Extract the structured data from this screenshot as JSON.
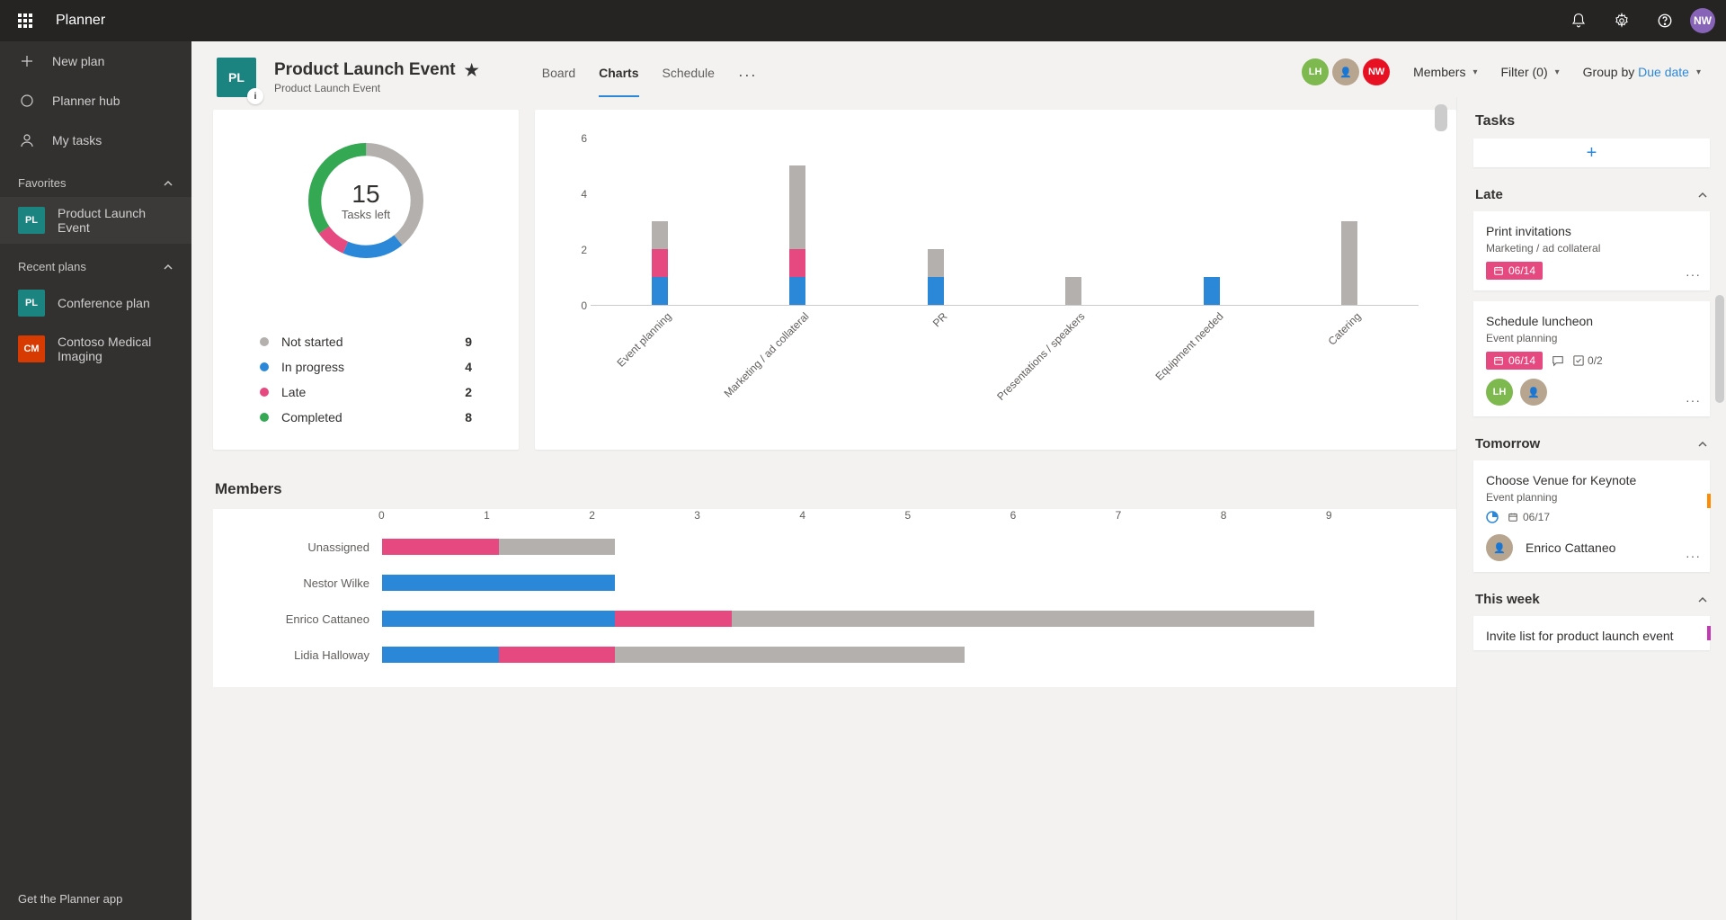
{
  "app_name": "Planner",
  "user_initials": "NW",
  "sidebar": {
    "new_plan": "New plan",
    "planner_hub": "Planner hub",
    "my_tasks": "My tasks",
    "favorites_label": "Favorites",
    "favorites": [
      {
        "initials": "PL",
        "name": "Product Launch Event",
        "color": "#1b8481",
        "active": true
      }
    ],
    "recent_label": "Recent plans",
    "recent": [
      {
        "initials": "PL",
        "name": "Conference plan",
        "color": "#1b8481"
      },
      {
        "initials": "CM",
        "name": "Contoso Medical Imaging",
        "color": "#d83b01"
      }
    ],
    "footer": "Get the Planner app"
  },
  "plan": {
    "initials": "PL",
    "title": "Product Launch Event",
    "subtitle": "Product Launch Event",
    "tabs": {
      "board": "Board",
      "charts": "Charts",
      "schedule": "Schedule"
    },
    "members_label": "Members",
    "filter_label": "Filter (0)",
    "group_label": "Group by ",
    "group_value": "Due date",
    "header_avatars": [
      {
        "initials": "LH",
        "color": "#7db94e"
      },
      {
        "initials": "",
        "color": "#b8a58f",
        "photo": true
      },
      {
        "initials": "NW",
        "color": "#e81123"
      }
    ]
  },
  "status_chart": {
    "center_number": "15",
    "center_label": "Tasks left",
    "legend": [
      {
        "label": "Not started",
        "value": "9",
        "color": "#b3b0ad"
      },
      {
        "label": "In progress",
        "value": "4",
        "color": "#2b88d8"
      },
      {
        "label": "Late",
        "value": "2",
        "color": "#e6497f"
      },
      {
        "label": "Completed",
        "value": "8",
        "color": "#34a853"
      }
    ]
  },
  "bucket_chart": {
    "categories": [
      "Event planning",
      "Marketing / ad collateral",
      "PR",
      "Presentations / speakers",
      "Equipment needed",
      "Catering"
    ]
  },
  "members_chart": {
    "title": "Members",
    "ticks": [
      "0",
      "1",
      "2",
      "3",
      "4",
      "5",
      "6",
      "7",
      "8",
      "9"
    ],
    "rows": [
      {
        "name": "Unassigned",
        "segments": [
          {
            "w": 1,
            "c": "#e6497f"
          },
          {
            "w": 1,
            "c": "#b3b0ad"
          }
        ]
      },
      {
        "name": "Nestor Wilke",
        "segments": [
          {
            "w": 2,
            "c": "#2b88d8"
          }
        ]
      },
      {
        "name": "Enrico Cattaneo",
        "segments": [
          {
            "w": 2,
            "c": "#2b88d8"
          },
          {
            "w": 1,
            "c": "#e6497f"
          },
          {
            "w": 5,
            "c": "#b3b0ad"
          }
        ]
      },
      {
        "name": "Lidia Halloway",
        "segments": [
          {
            "w": 1,
            "c": "#2b88d8"
          },
          {
            "w": 1,
            "c": "#e6497f"
          },
          {
            "w": 3,
            "c": "#b3b0ad"
          }
        ]
      }
    ]
  },
  "right": {
    "header": "Tasks",
    "sections": {
      "late": "Late",
      "tomorrow": "Tomorrow",
      "this_week": "This week"
    },
    "late_tasks": [
      {
        "title": "Print invitations",
        "bucket": "Marketing / ad collateral",
        "date": "06/14",
        "badge": true
      },
      {
        "title": "Schedule luncheon",
        "bucket": "Event planning",
        "date": "06/14",
        "badge": true,
        "comment": true,
        "checklist": "0/2",
        "avatars": [
          {
            "initials": "LH",
            "color": "#7db94e"
          },
          {
            "initials": "",
            "color": "#b8a58f",
            "photo": true
          }
        ]
      }
    ],
    "tomorrow_tasks": [
      {
        "title": "Choose Venue for Keynote",
        "bucket": "Event planning",
        "date": "06/17",
        "badge": false,
        "progress_icon": true,
        "assignee": "Enrico Cattaneo",
        "strip": "#ff8c00"
      }
    ],
    "week_tasks": [
      {
        "title": "Invite list for product launch event",
        "strip": "#c239b3"
      }
    ]
  },
  "chart_data": [
    {
      "type": "pie",
      "title": "Task status",
      "series": [
        {
          "name": "Not started",
          "value": 9
        },
        {
          "name": "In progress",
          "value": 4
        },
        {
          "name": "Late",
          "value": 2
        },
        {
          "name": "Completed",
          "value": 8
        }
      ],
      "annotation": "15 Tasks left"
    },
    {
      "type": "bar",
      "title": "Tasks by bucket",
      "stacked": true,
      "categories": [
        "Event planning",
        "Marketing / ad collateral",
        "PR",
        "Presentations / speakers",
        "Equipment needed",
        "Catering"
      ],
      "series": [
        {
          "name": "In progress",
          "values": [
            1,
            1,
            1,
            0,
            1,
            0
          ],
          "color": "#2b88d8"
        },
        {
          "name": "Late",
          "values": [
            1,
            1,
            0,
            0,
            0,
            0
          ],
          "color": "#e6497f"
        },
        {
          "name": "Not started",
          "values": [
            1,
            3,
            1,
            1,
            0,
            3
          ],
          "color": "#b3b0ad"
        }
      ],
      "ylabel": "",
      "ylim": [
        0,
        6
      ],
      "yticks": [
        0,
        2,
        4,
        6
      ]
    },
    {
      "type": "bar",
      "orientation": "horizontal",
      "title": "Members",
      "stacked": true,
      "categories": [
        "Unassigned",
        "Nestor Wilke",
        "Enrico Cattaneo",
        "Lidia Halloway"
      ],
      "series": [
        {
          "name": "In progress",
          "values": [
            0,
            2,
            2,
            1
          ],
          "color": "#2b88d8"
        },
        {
          "name": "Late",
          "values": [
            1,
            0,
            1,
            1
          ],
          "color": "#e6497f"
        },
        {
          "name": "Not started",
          "values": [
            1,
            0,
            5,
            3
          ],
          "color": "#b3b0ad"
        }
      ],
      "xlim": [
        0,
        9
      ],
      "xticks": [
        0,
        1,
        2,
        3,
        4,
        5,
        6,
        7,
        8,
        9
      ]
    }
  ]
}
